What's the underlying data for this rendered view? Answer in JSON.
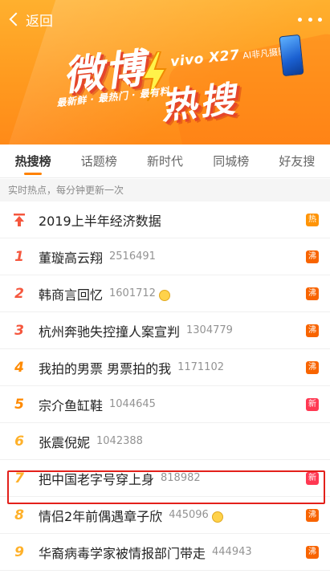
{
  "header": {
    "back_label": "返回",
    "title_line1": "微博",
    "title_line2": "热搜",
    "slogan": "最新鲜 · 最热门 · 最有料",
    "ad_brand": "vivo X27",
    "ad_tagline": "AI非凡摄影"
  },
  "tabs": [
    {
      "label": "热搜榜",
      "active": true
    },
    {
      "label": "话题榜",
      "active": false
    },
    {
      "label": "新时代",
      "active": false
    },
    {
      "label": "同城榜",
      "active": false
    },
    {
      "label": "好友搜",
      "active": false
    }
  ],
  "subheader": "实时热点，每分钟更新一次",
  "list": [
    {
      "rank": "",
      "topic": "2019上半年经济数据",
      "count": "",
      "badge": "热",
      "badge_type": "hot",
      "pinned": true
    },
    {
      "rank": "1",
      "topic": "董璇高云翔",
      "count": "2516491",
      "badge": "沸",
      "badge_type": "boil"
    },
    {
      "rank": "2",
      "topic": "韩商言回忆",
      "count": "1601712",
      "badge": "沸",
      "badge_type": "boil",
      "emoji": true
    },
    {
      "rank": "3",
      "topic": "杭州奔驰失控撞人案宣判",
      "count": "1304779",
      "badge": "沸",
      "badge_type": "boil"
    },
    {
      "rank": "4",
      "topic": "我拍的男票 男票拍的我",
      "count": "1171102",
      "badge": "沸",
      "badge_type": "boil"
    },
    {
      "rank": "5",
      "topic": "宗介鱼缸鞋",
      "count": "1044645",
      "badge": "新",
      "badge_type": "new"
    },
    {
      "rank": "6",
      "topic": "张震倪妮",
      "count": "1042388",
      "badge": "",
      "badge_type": ""
    },
    {
      "rank": "7",
      "topic": "把中国老字号穿上身",
      "count": "818982",
      "badge": "新",
      "badge_type": "new"
    },
    {
      "rank": "8",
      "topic": "情侣2年前偶遇章子欣",
      "count": "445096",
      "badge": "沸",
      "badge_type": "boil",
      "emoji": true
    },
    {
      "rank": "9",
      "topic": "华裔病毒学家被情报部门带走",
      "count": "444943",
      "badge": "沸",
      "badge_type": "boil"
    }
  ],
  "colors": {
    "accent": "#ff8200",
    "rank_top": "#f5573e",
    "rank_mid": "#ff8a00",
    "rank_low": "#ffb12a",
    "highlight": "#e3201b"
  }
}
